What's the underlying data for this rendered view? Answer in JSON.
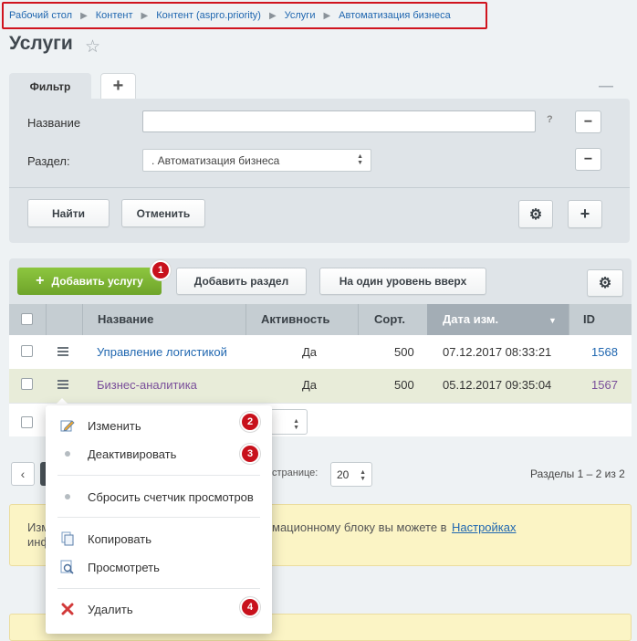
{
  "breadcrumb": [
    "Рабочий стол",
    "Контент",
    "Контент (aspro.priority)",
    "Услуги",
    "Автоматизация бизнеса"
  ],
  "page_title": "Услуги",
  "filter": {
    "tab_label": "Фильтр",
    "name_label": "Название",
    "name_value": "",
    "help": "?",
    "section_label": "Раздел:",
    "section_value": ". Автоматизация бизнеса",
    "find_button": "Найти",
    "cancel_button": "Отменить"
  },
  "toolbar": {
    "add_service": "Добавить услугу",
    "add_section": "Добавить раздел",
    "level_up": "На один уровень вверх"
  },
  "table": {
    "columns": [
      "Название",
      "Активность",
      "Сорт.",
      "Дата изм.",
      "ID"
    ],
    "rows": [
      {
        "name": "Управление логистикой",
        "active": "Да",
        "sort": "500",
        "date": "07.12.2017 08:33:21",
        "id": "1568"
      },
      {
        "name": "Бизнес-аналитика",
        "active": "Да",
        "sort": "500",
        "date": "05.12.2017 09:35:04",
        "id": "1567"
      }
    ]
  },
  "pager": {
    "per_page_label": "странице:",
    "per_page_value": "20",
    "summary": "Разделы 1 – 2 из 2"
  },
  "notice": {
    "text_left_1": "Изм",
    "text_left_2": "инф",
    "text_mid": "мационному блоку вы можете в",
    "link": "Настройках"
  },
  "context_menu": {
    "items": [
      "Изменить",
      "Деактивировать",
      "Сбросить счетчик просмотров",
      "Копировать",
      "Просмотреть",
      "Удалить"
    ]
  },
  "badges": [
    "1",
    "2",
    "3",
    "4"
  ],
  "colors": {
    "accent": "#2067b0",
    "add_button": "#7db535",
    "badge": "#c8111c",
    "highlight_row": "#e8ecd9",
    "notice_bg": "#fbf4c5"
  }
}
